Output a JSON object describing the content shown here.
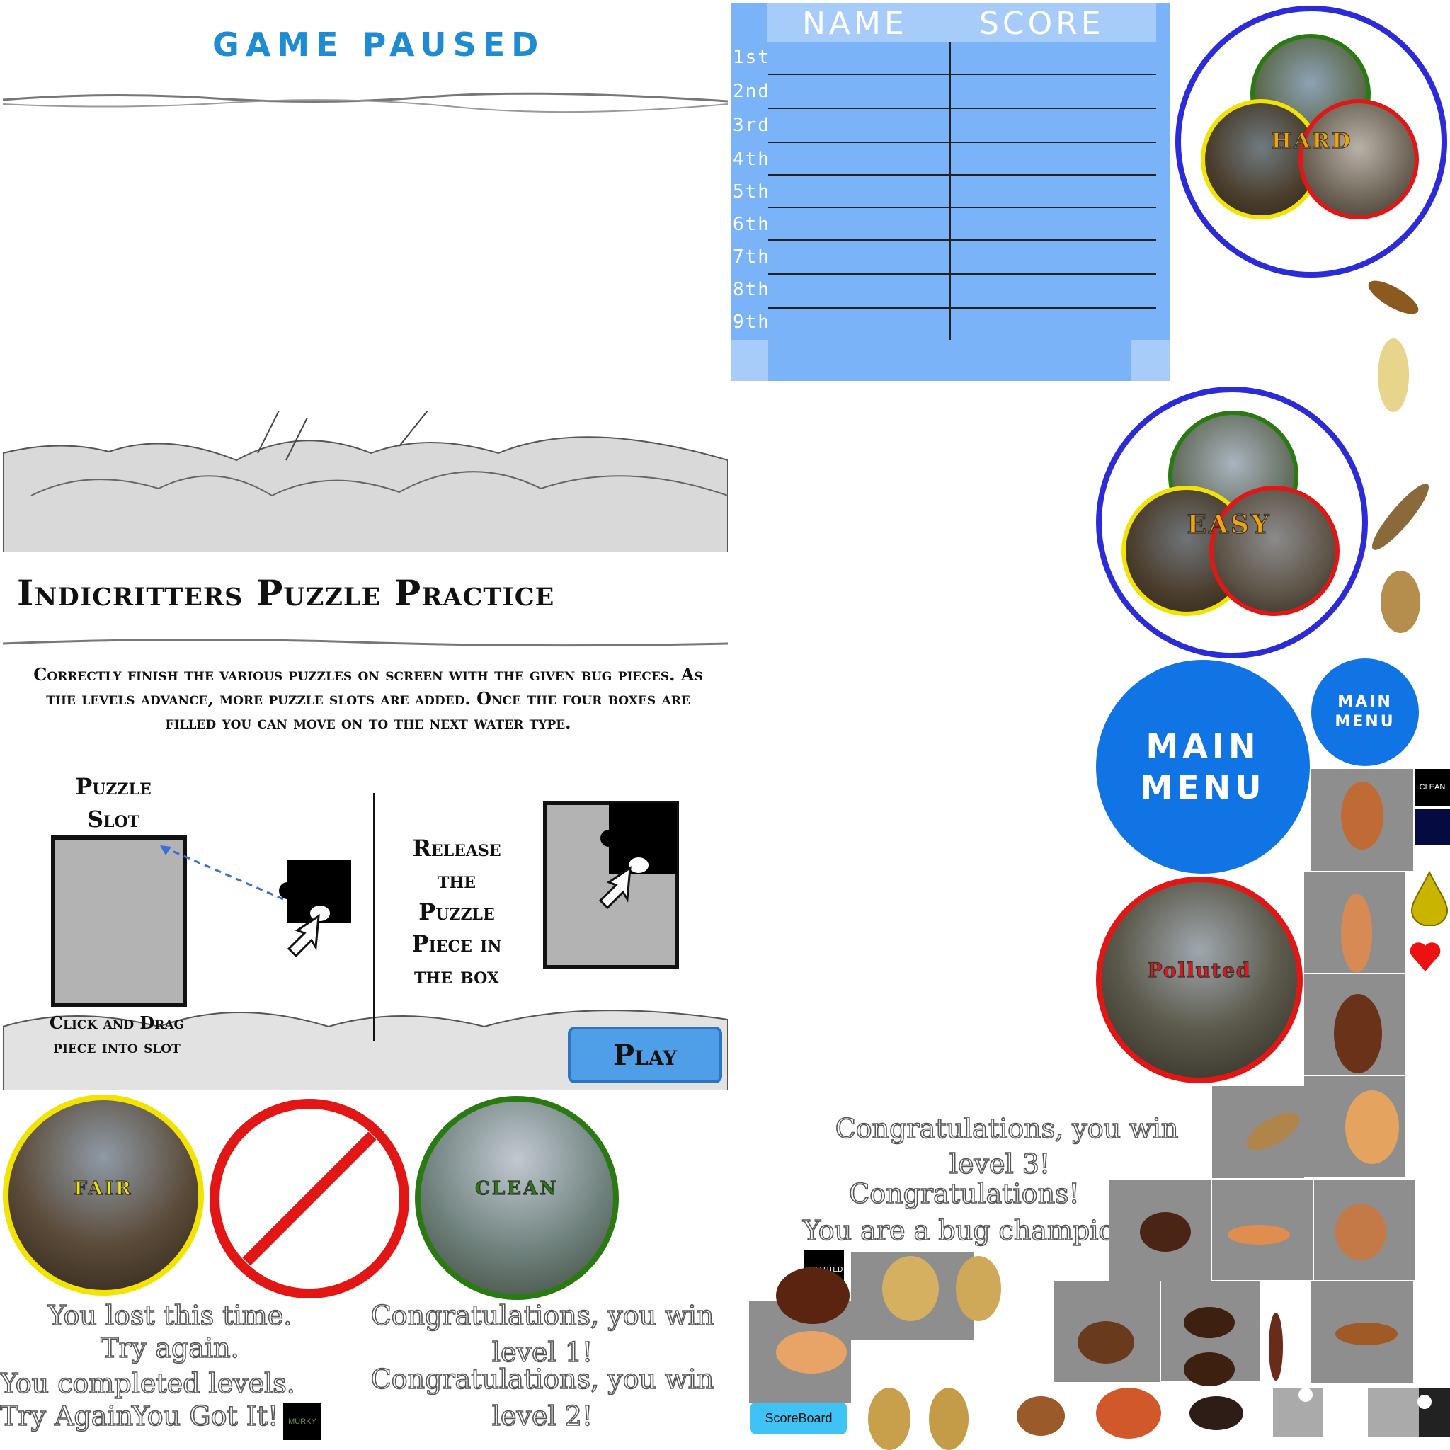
{
  "pause": {
    "title": "GAME PAUSED"
  },
  "tutorial": {
    "title": "Indicritters Puzzle Practice",
    "instructions": "Correctly finish the various puzzles on screen with the given bug pieces. As the levels advance, more puzzle slots are added.  Once the four boxes are filled you can move on to the next water type.",
    "slot_label_1": "Puzzle",
    "slot_label_2": "Slot",
    "drag_label_1": "Click and Drag",
    "drag_label_2": "piece into slot",
    "release_1": "Release",
    "release_2": "the",
    "release_3": "Puzzle",
    "release_4": "Piece in",
    "release_5": "the box",
    "play_label": "Play"
  },
  "scoreboard": {
    "col_name": "NAME",
    "col_score": "SCORE",
    "ranks": [
      "1st",
      "2nd",
      "3rd",
      "4th",
      "5th",
      "6th",
      "7th",
      "8th",
      "9th"
    ],
    "button_label": "ScoreBoard"
  },
  "difficulty": {
    "hard": "HARD",
    "easy": "EASY"
  },
  "menu": {
    "main_large_1": "MAIN",
    "main_large_2": "MENU",
    "main_small_1": "MAIN",
    "main_small_2": "MENU"
  },
  "water": {
    "fair": "FAIR",
    "clean": "CLEAN",
    "polluted": "Polluted"
  },
  "tags": {
    "clean": "CLEAN",
    "polluted": "POLLUTED",
    "murky": "MURKY"
  },
  "messages": {
    "lost_1": "You lost this time.",
    "lost_2": "Try again.",
    "completed": "You completed   levels.",
    "try_again": "Try Again",
    "got_it": "You Got It!",
    "win1_a": "Congratulations, you win",
    "win1_b": "level 1!",
    "win2_a": "Congratulations, you win",
    "win2_b": "level 2!",
    "win3_a": "Congratulations, you win",
    "win3_b": "level 3!",
    "champ_a": "Congratulations!",
    "champ_b": "You are a bug champion!"
  },
  "colors": {
    "accent": "#1f8bd3",
    "board": "#7ab3f7",
    "menu": "#1174e4",
    "ring_blue": "#2b2bd9",
    "ring_red": "#e31616",
    "ring_green": "#2a7a12",
    "ring_yellow": "#f2e400"
  }
}
